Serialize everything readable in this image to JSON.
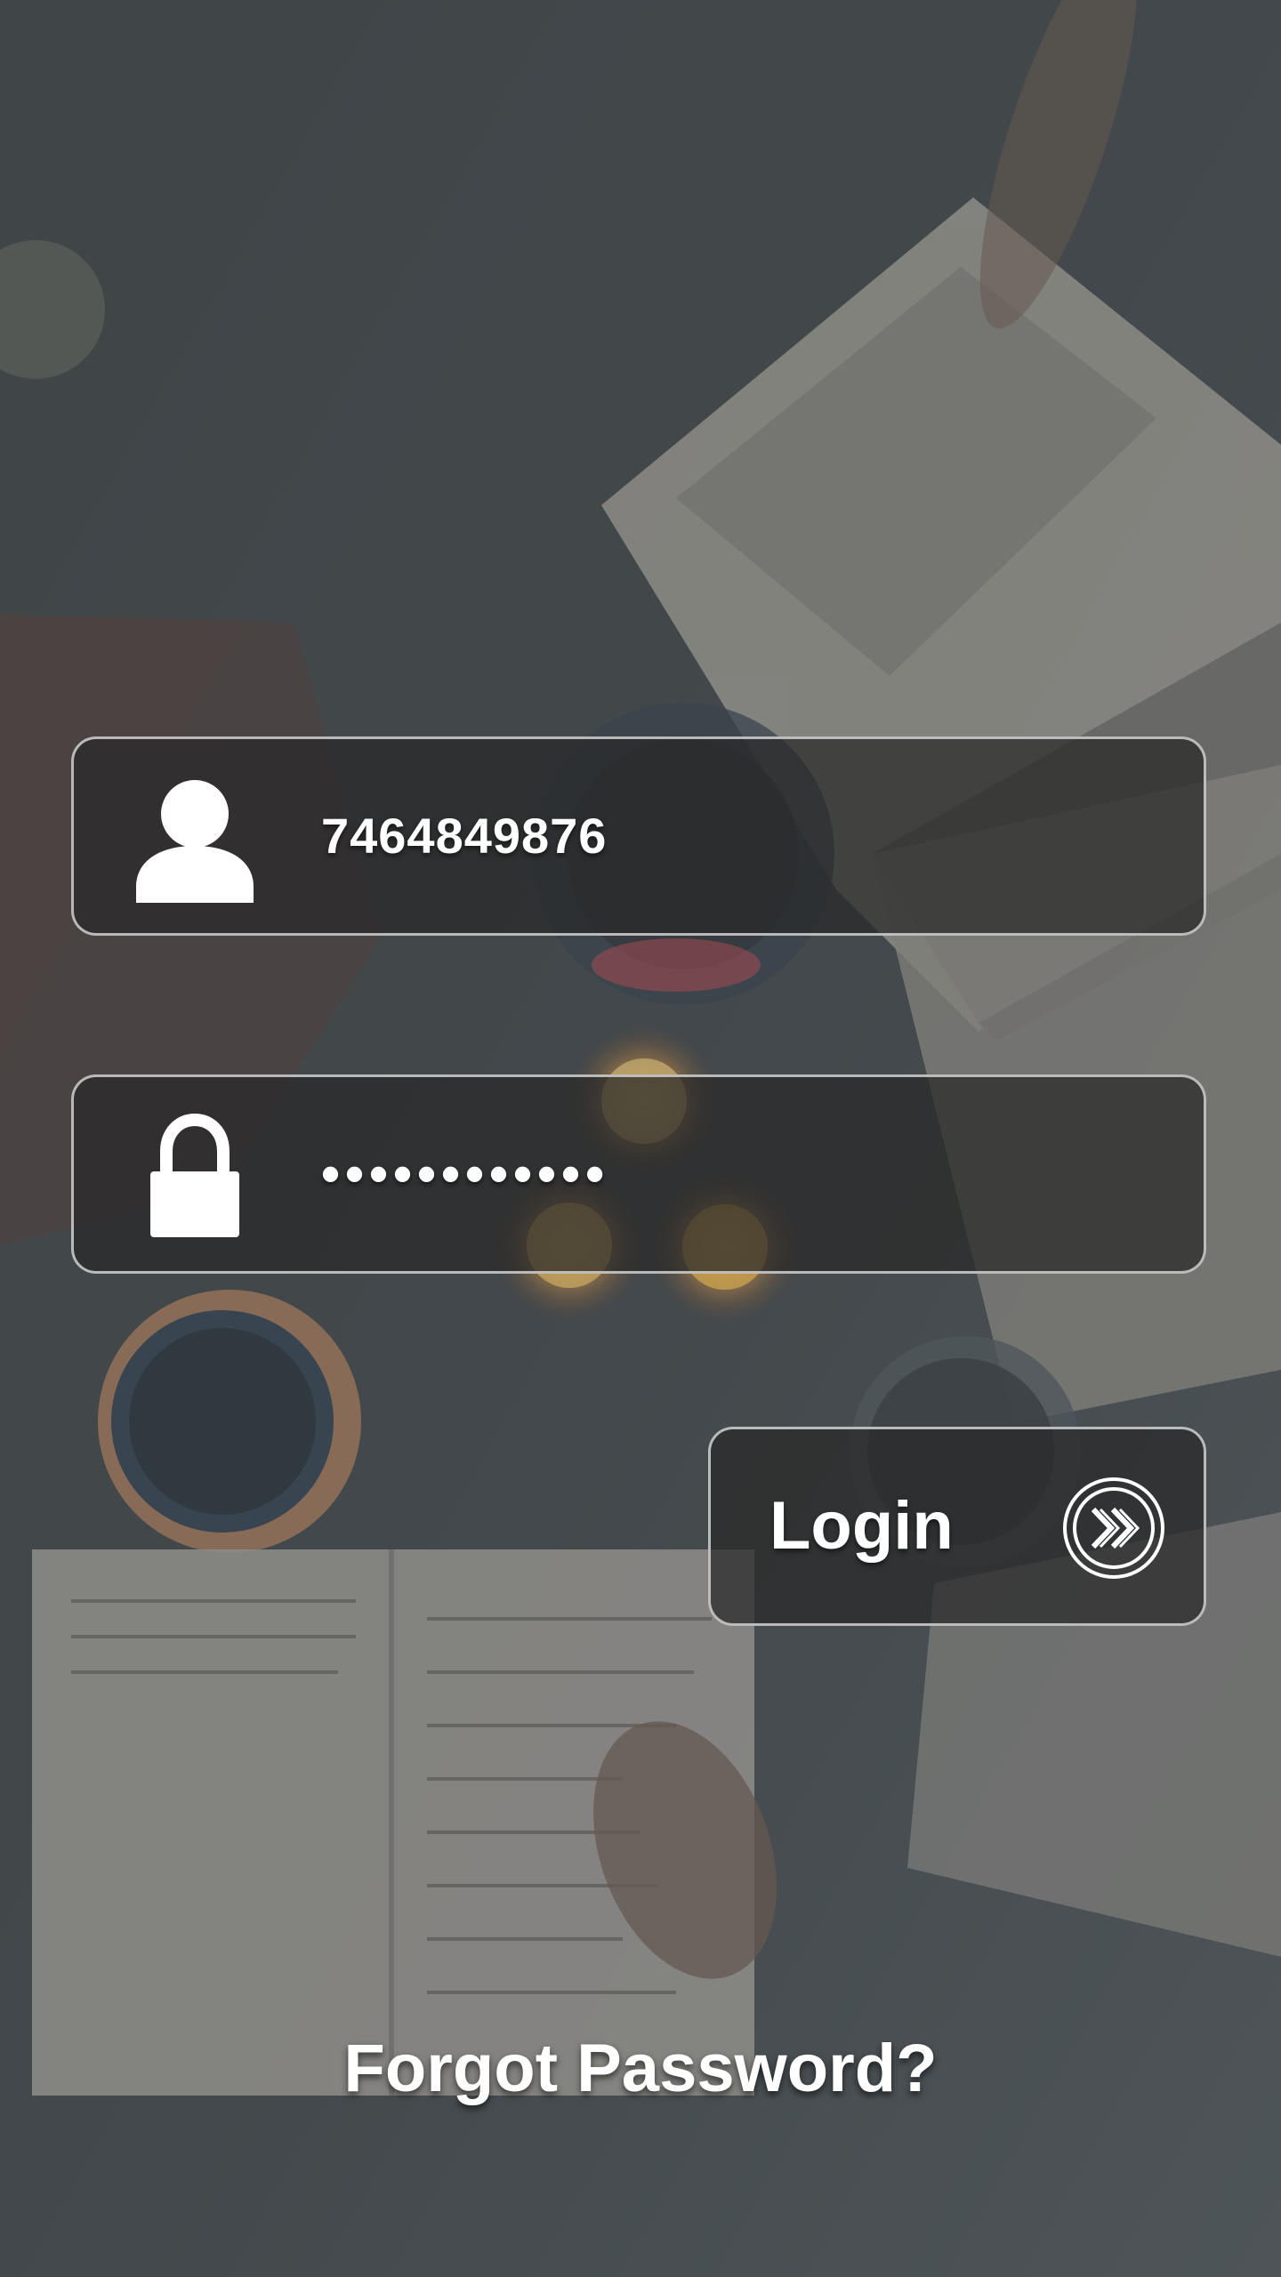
{
  "login_form": {
    "username": {
      "value": "7464849876",
      "icon": "user-icon"
    },
    "password": {
      "value": "••••••••••••",
      "icon": "lock-icon"
    },
    "login_button": {
      "label": "Login",
      "icon": "double-chevron-right-icon"
    },
    "forgot_password": {
      "label": "Forgot Password?"
    }
  },
  "colors": {
    "text": "#ffffff",
    "field_background": "#282828",
    "field_border": "#d2d2d2"
  }
}
